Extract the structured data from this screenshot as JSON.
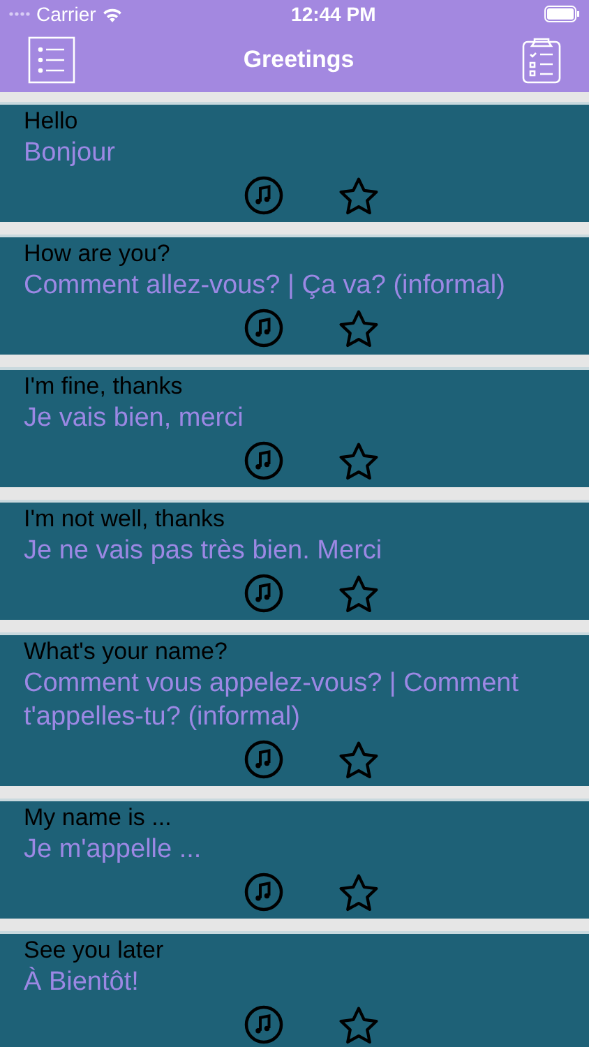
{
  "status_bar": {
    "carrier": "Carrier",
    "time": "12:44 PM"
  },
  "nav": {
    "title": "Greetings"
  },
  "phrases": [
    {
      "english": "Hello",
      "french": "Bonjour",
      "favorite": false
    },
    {
      "english": "How are you?",
      "french": "Comment allez-vous? | Ça va? (informal)",
      "favorite": false
    },
    {
      "english": "I'm fine, thanks",
      "french": "Je vais bien, merci",
      "favorite": false
    },
    {
      "english": "I'm not well, thanks",
      "french": "Je ne vais pas très bien. Merci",
      "favorite": false
    },
    {
      "english": "What's your name?",
      "french": "Comment vous appelez-vous? | Comment t'appelles-tu? (informal)",
      "favorite": false
    },
    {
      "english": "My name is ...",
      "french": "Je m'appelle ...",
      "favorite": false
    },
    {
      "english": "See you later",
      "french": "À Bientôt!",
      "favorite": false
    }
  ]
}
